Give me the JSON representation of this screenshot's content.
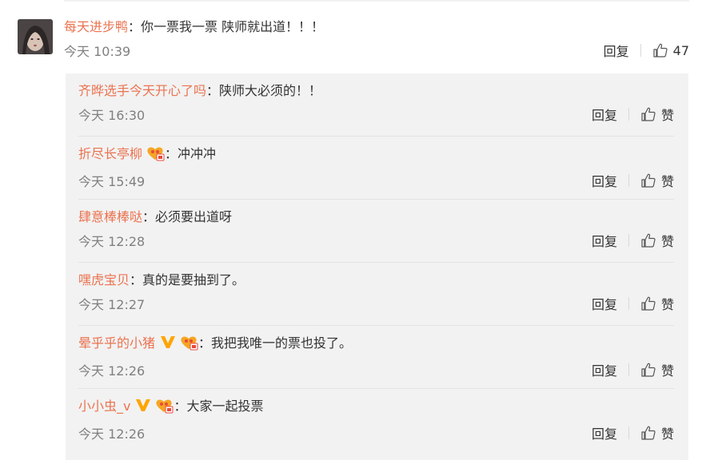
{
  "main_comment": {
    "username": "每天进步鸭",
    "text": "你一票我一票 陕师就出道！！！",
    "time": "今天 10:39",
    "reply_label": "回复",
    "like_count": "47"
  },
  "replies": [
    {
      "username": "齐晔选手今天开心了吗",
      "text": "陕师大必须的！！",
      "time": "今天 16:30",
      "reply_label": "回复",
      "like_label": "赞"
    },
    {
      "username": "折尽长亭柳",
      "text": "冲冲冲",
      "time": "今天 15:49",
      "reply_label": "回复",
      "like_label": "赞"
    },
    {
      "username": "肆意棒棒哒",
      "text": "必须要出道呀",
      "time": "今天 12:28",
      "reply_label": "回复",
      "like_label": "赞"
    },
    {
      "username": "嘿虎宝贝",
      "text": "真的是要抽到了。",
      "time": "今天 12:27",
      "reply_label": "回复",
      "like_label": "赞"
    },
    {
      "username": "晕乎乎的小猪",
      "text": "我把我唯一的票也投了。",
      "time": "今天 12:26",
      "reply_label": "回复",
      "like_label": "赞"
    },
    {
      "username": "小小虫_v",
      "text": "大家一起投票",
      "time": "今天 12:26",
      "reply_label": "回复",
      "like_label": "赞"
    }
  ],
  "colors": {
    "username": "#eb7350",
    "meta": "#808080",
    "vip": "#ffa500",
    "badge": "#f5a623"
  }
}
